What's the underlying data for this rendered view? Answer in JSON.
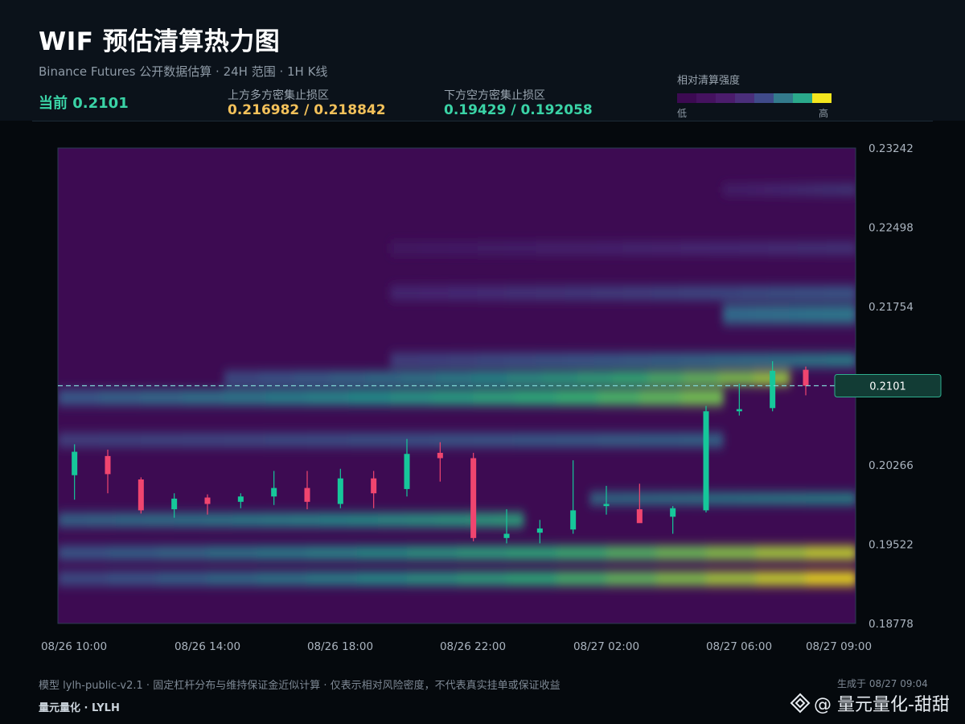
{
  "header": {
    "title": "WIF 预估清算热力图",
    "subtitle": "Binance Futures 公开数据估算 · 24H 范围 · 1H K线",
    "current_label": "当前 0.2101",
    "upper_zone_label": "上方多方密集止损区",
    "upper_zone_value": "0.216982 / 0.218842",
    "lower_zone_label": "下方空方密集止损区",
    "lower_zone_value": "0.19429 / 0.192058"
  },
  "legend": {
    "title": "相对清算强度",
    "low": "低",
    "high": "高",
    "colors": [
      "#3c0a52",
      "#45125f",
      "#4b1c6c",
      "#4a2e7a",
      "#3f4a89",
      "#337a8c",
      "#2aa98b",
      "#f4e61e"
    ]
  },
  "colors": {
    "current_price_line": "#7fd4d4",
    "up_candle": "#16c79a",
    "down_candle": "#f0456f",
    "heatmap_low": "#3d0b52",
    "heatmap_high": "#f7e81c"
  },
  "chart_data": {
    "type": "heatmap",
    "title": "WIF 预估清算热力图",
    "y_ticks": [
      "0.23242",
      "0.22498",
      "0.21754",
      "0.20266",
      "0.19522",
      "0.18778"
    ],
    "ylim": [
      0.18778,
      0.23242
    ],
    "x_ticks": [
      "08/26 10:00",
      "08/26 14:00",
      "08/26 18:00",
      "08/26 22:00",
      "08/27 02:00",
      "08/27 06:00",
      "08/27 09:00"
    ],
    "current_price": 0.2101,
    "current_price_label": "0.2101",
    "heat_bands": [
      {
        "center": 0.192,
        "start": 0,
        "end": 24,
        "start_intensity": 0.35,
        "end_intensity": 1.0,
        "width": 0.0012
      },
      {
        "center": 0.1944,
        "start": 0,
        "end": 24,
        "start_intensity": 0.4,
        "end_intensity": 0.95,
        "width": 0.0012
      },
      {
        "center": 0.1975,
        "start": 0,
        "end": 14,
        "start_intensity": 0.45,
        "end_intensity": 0.7,
        "width": 0.0012
      },
      {
        "center": 0.1995,
        "start": 16,
        "end": 24,
        "start_intensity": 0.5,
        "end_intensity": 0.6,
        "width": 0.001
      },
      {
        "center": 0.209,
        "start": 0,
        "end": 20,
        "start_intensity": 0.4,
        "end_intensity": 0.85,
        "width": 0.0014
      },
      {
        "center": 0.2108,
        "start": 5,
        "end": 22,
        "start_intensity": 0.35,
        "end_intensity": 0.9,
        "width": 0.0012
      },
      {
        "center": 0.205,
        "start": 0,
        "end": 20,
        "start_intensity": 0.3,
        "end_intensity": 0.45,
        "width": 0.0012
      },
      {
        "center": 0.2125,
        "start": 10,
        "end": 24,
        "start_intensity": 0.3,
        "end_intensity": 0.55,
        "width": 0.0012
      },
      {
        "center": 0.2168,
        "start": 20,
        "end": 24,
        "start_intensity": 0.45,
        "end_intensity": 0.5,
        "width": 0.0018
      },
      {
        "center": 0.2188,
        "start": 10,
        "end": 24,
        "start_intensity": 0.18,
        "end_intensity": 0.4,
        "width": 0.0012
      },
      {
        "center": 0.223,
        "start": 10,
        "end": 24,
        "start_intensity": 0.1,
        "end_intensity": 0.25,
        "width": 0.001
      },
      {
        "center": 0.2285,
        "start": 20,
        "end": 24,
        "start_intensity": 0.15,
        "end_intensity": 0.3,
        "width": 0.0008
      }
    ],
    "candles": [
      {
        "t": 0,
        "o": 0.2017,
        "h": 0.2046,
        "l": 0.1994,
        "c": 0.2039
      },
      {
        "t": 1,
        "o": 0.2035,
        "h": 0.2041,
        "l": 0.2,
        "c": 0.2018
      },
      {
        "t": 2,
        "o": 0.2013,
        "h": 0.2015,
        "l": 0.1981,
        "c": 0.1984
      },
      {
        "t": 3,
        "o": 0.1985,
        "h": 0.2,
        "l": 0.1977,
        "c": 0.1995
      },
      {
        "t": 4,
        "o": 0.1996,
        "h": 0.1999,
        "l": 0.198,
        "c": 0.199
      },
      {
        "t": 5,
        "o": 0.1992,
        "h": 0.2,
        "l": 0.1986,
        "c": 0.1997
      },
      {
        "t": 6,
        "o": 0.1997,
        "h": 0.2021,
        "l": 0.1989,
        "c": 0.2005
      },
      {
        "t": 7,
        "o": 0.2005,
        "h": 0.2021,
        "l": 0.1985,
        "c": 0.1992
      },
      {
        "t": 8,
        "o": 0.199,
        "h": 0.2023,
        "l": 0.1986,
        "c": 0.2014
      },
      {
        "t": 9,
        "o": 0.2014,
        "h": 0.2021,
        "l": 0.1986,
        "c": 0.2
      },
      {
        "t": 10,
        "o": 0.2004,
        "h": 0.2051,
        "l": 0.1997,
        "c": 0.2037
      },
      {
        "t": 11,
        "o": 0.2038,
        "h": 0.2048,
        "l": 0.2011,
        "c": 0.2033
      },
      {
        "t": 12,
        "o": 0.2033,
        "h": 0.2038,
        "l": 0.1955,
        "c": 0.1958
      },
      {
        "t": 13,
        "o": 0.1958,
        "h": 0.1985,
        "l": 0.1953,
        "c": 0.1962
      },
      {
        "t": 14,
        "o": 0.1963,
        "h": 0.1975,
        "l": 0.1953,
        "c": 0.1967
      },
      {
        "t": 15,
        "o": 0.1966,
        "h": 0.2031,
        "l": 0.1962,
        "c": 0.1984
      },
      {
        "t": 16,
        "o": 0.1988,
        "h": 0.2007,
        "l": 0.198,
        "c": 0.199
      },
      {
        "t": 17,
        "o": 0.1985,
        "h": 0.2009,
        "l": 0.1978,
        "c": 0.1972
      },
      {
        "t": 18,
        "o": 0.1978,
        "h": 0.1988,
        "l": 0.1962,
        "c": 0.1986
      },
      {
        "t": 19,
        "o": 0.1984,
        "h": 0.2082,
        "l": 0.1982,
        "c": 0.2077
      },
      {
        "t": 20,
        "o": 0.2077,
        "h": 0.2103,
        "l": 0.2073,
        "c": 0.2079
      },
      {
        "t": 21,
        "o": 0.208,
        "h": 0.2124,
        "l": 0.2077,
        "c": 0.2115
      },
      {
        "t": 22,
        "o": 0.2116,
        "h": 0.2119,
        "l": 0.2092,
        "c": 0.2101
      }
    ],
    "x_span": 24
  },
  "footer": {
    "note": "模型 lylh-public-v2.1 · 固定杠杆分布与维持保证金近似计算 · 仅表示相对风险密度，不代表真实挂单或保证收益",
    "brand": "量元量化 · LYLH",
    "generated": "生成于 08/27 09:04",
    "watermark": "@ 量元量化-甜甜"
  }
}
